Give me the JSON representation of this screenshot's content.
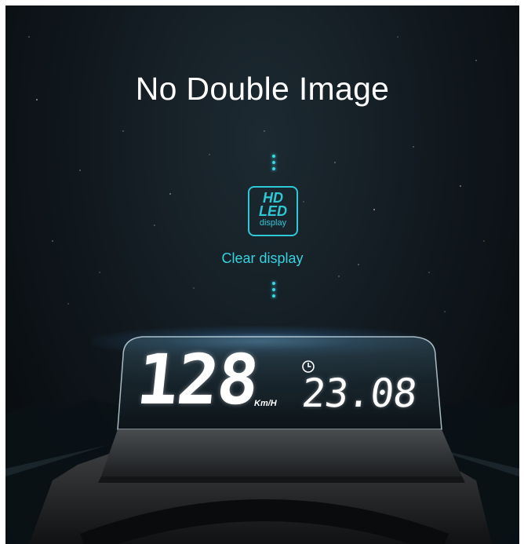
{
  "headline": "No Double Image",
  "badge": {
    "line1": "HD",
    "line2": "LED",
    "line3": "display"
  },
  "caption": "Clear display",
  "hud": {
    "speed": "128",
    "unit": "Km/H",
    "time": "23.08"
  },
  "colors": {
    "accent": "#36d2e0",
    "background": "#0e151a",
    "text": "#ffffff"
  },
  "icons": [
    "clock-icon"
  ]
}
